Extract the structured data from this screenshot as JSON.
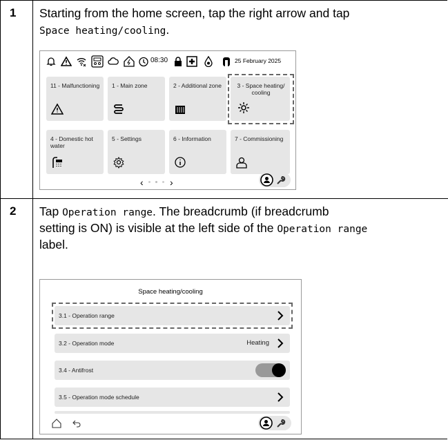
{
  "steps": [
    {
      "number": "1",
      "text_before": "Starting from the home screen, tap the right arrow and tap",
      "code": "Space heating/cooling",
      "text_after": "."
    },
    {
      "number": "2",
      "line1_prefix": "Tap ",
      "line1_code": "Operation range",
      "line1_suffix": ". The breadcrumb (if breadcrumb",
      "line2_prefix": "setting is ON) is visible at the left side of the ",
      "line2_code": "Operation range",
      "line3": "label."
    }
  ],
  "home_screen": {
    "status_bar": {
      "icons": [
        "bell-icon",
        "warning-icon",
        "wifi-icon",
        "device-icon",
        "cloud-icon",
        "home-energy-icon",
        "power-clock-icon",
        "lock-icon",
        "first-aid-icon",
        "water-drop-icon",
        "tank-icon"
      ],
      "time": "08:30",
      "date": "25  February 2025"
    },
    "tiles": [
      {
        "label": "11 - Malfunctioning",
        "icon": "warning-icon"
      },
      {
        "label": "1 - Main zone",
        "icon": "zone-icon"
      },
      {
        "label": "2 - Additional zone",
        "icon": "radiator-icon"
      },
      {
        "label": "3 - Space heating/ cooling",
        "icon": "heat-cool-icon"
      },
      {
        "label": "4 - Domestic hot water",
        "icon": "shower-icon"
      },
      {
        "label": "5 - Settings",
        "icon": "gear-icon"
      },
      {
        "label": "6 - Information",
        "icon": "info-icon"
      },
      {
        "label": "7 - Commissioning",
        "icon": "user-icon"
      }
    ],
    "pager": {
      "left": "‹",
      "right": "›"
    }
  },
  "menu_screen": {
    "title": "Space heating/cooling",
    "rows": [
      {
        "label": "3.1 - Operation range",
        "value": "",
        "control": "chevron"
      },
      {
        "label": "3.2 - Operation mode",
        "value": "Heating",
        "control": "chevron"
      },
      {
        "label": "3.4 - Antifrost",
        "value": "",
        "control": "toggle-on"
      },
      {
        "label": "3.5 - Operation mode schedule",
        "value": "",
        "control": "chevron"
      }
    ]
  },
  "colors": {
    "tile_bg": "#e6e6e6",
    "dash": "#666666",
    "border": "#000000"
  }
}
